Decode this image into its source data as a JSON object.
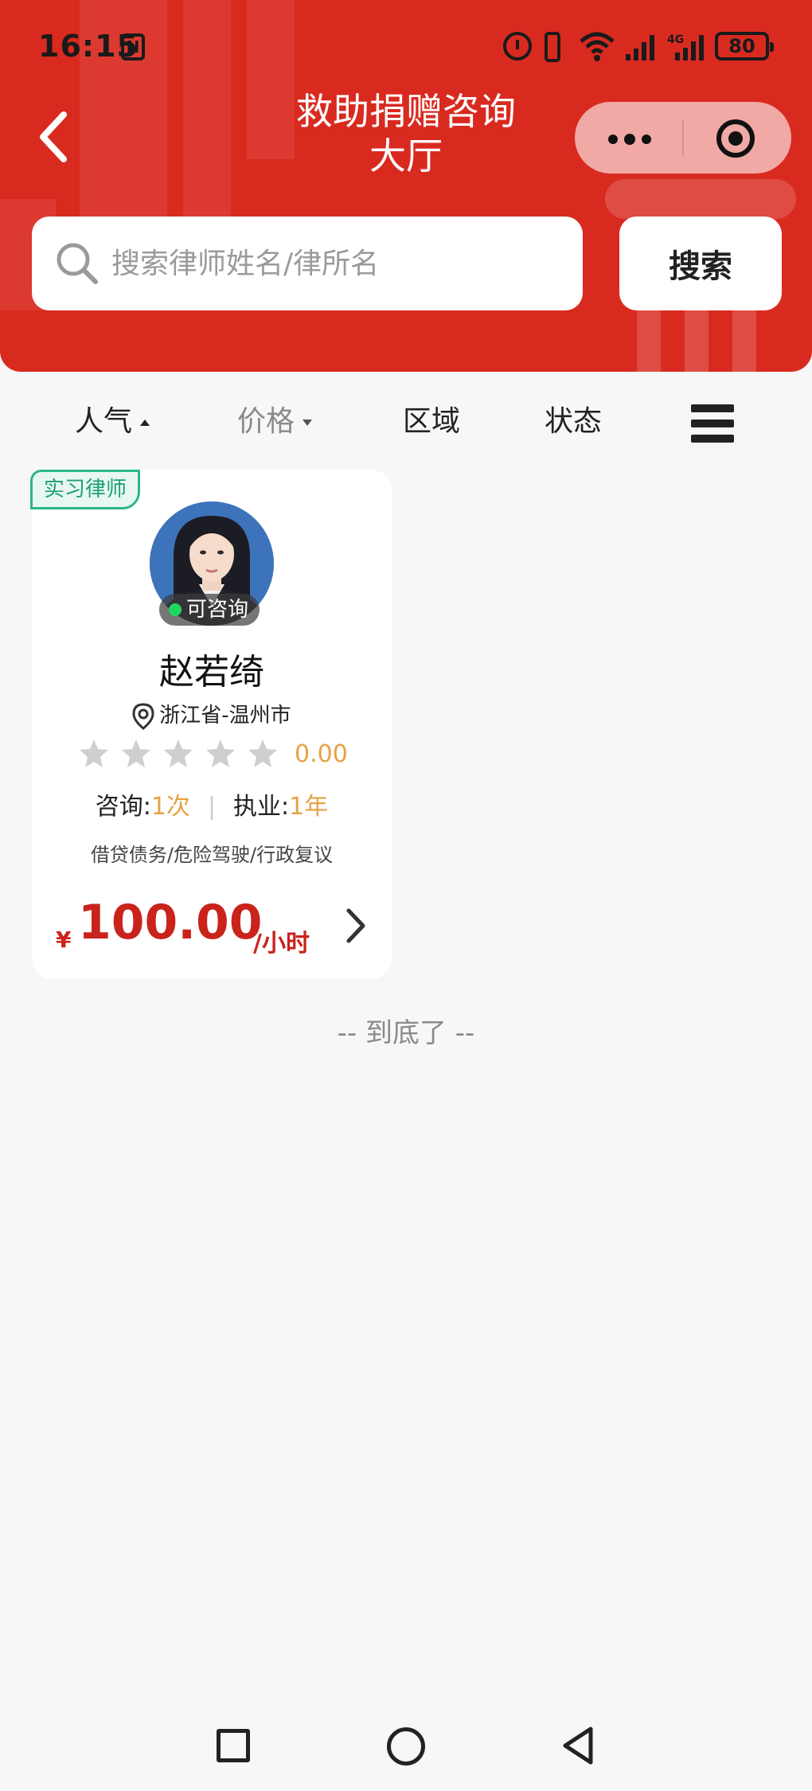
{
  "status_bar": {
    "time": "16:15",
    "nfc_label": "N",
    "battery": "80",
    "network": "4G"
  },
  "nav": {
    "title": "救助捐赠咨询大厅"
  },
  "search": {
    "placeholder": "搜索律师姓名/律所名",
    "button_label": "搜索"
  },
  "filters": [
    {
      "label": "人气",
      "caret": "up"
    },
    {
      "label": "价格",
      "caret": "down"
    },
    {
      "label": "区域"
    },
    {
      "label": "状态"
    }
  ],
  "lawyers": [
    {
      "badge": "实习律师",
      "status": "可咨询",
      "name": "赵若绮",
      "location": "浙江省-温州市",
      "rating": "0.00",
      "stars": 0,
      "consult_label": "咨询:",
      "consult_value": "1次",
      "practice_label": "执业:",
      "practice_value": "1年",
      "specialties": "借贷债务/危险驾驶/行政复议",
      "currency": "¥",
      "price": "100.00",
      "unit": "/小时"
    }
  ],
  "footer": {
    "end_text": "-- 到底了 --"
  },
  "colors": {
    "header_red": "#d92a20",
    "price_red": "#c9231c",
    "accent_orange": "#e6a244",
    "badge_green": "#2cb68b",
    "online_green": "#1ed760"
  }
}
